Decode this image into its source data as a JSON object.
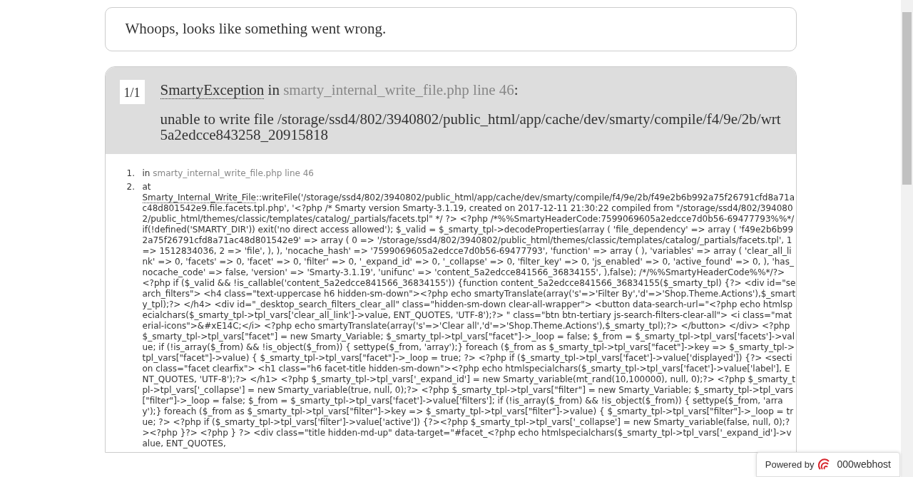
{
  "notice": "Whoops, looks like something went wrong.",
  "exception": {
    "counter": "1/1",
    "class": "SmartyException",
    "in": "in",
    "location": "smarty_internal_write_file.php line 46",
    "colon": ":",
    "message": "unable to write file /storage/ssd4/802/3940802/public_html/app/cache/dev/smarty/compile/f4/9e/2b/wrt5a2edcce843258_20915818"
  },
  "trace": [
    {
      "kind": "location",
      "number": "1.",
      "prefix": "in",
      "location": "smarty_internal_write_file.php line 46"
    },
    {
      "kind": "call",
      "number": "2.",
      "prefix": "at",
      "class": "Smarty_Internal_Write_File",
      "call": "::writeFile('/storage/ssd4/802/3940802/public_html/app/cache/dev/smarty/compile/f4/9e/2b/f49e2b6b992a75f26791cfd8a71ac48d801542e9.file.facets.tpl.php', '<?php /* Smarty version Smarty-3.1.19, created on 2017-12-11 21:30:22 compiled from \"/storage/ssd4/802/3940802/public_html/themes/classic/templates/catalog/_partials/facets.tpl\" */ ?> <?php /*%%SmartyHeaderCode:7599069605a2edcce7d0b56-69477793%%*/if(!defined('SMARTY_DIR')) exit('no direct access allowed'); $_valid = $_smarty_tpl->decodeProperties(array ( 'file_dependency' => array ( 'f49e2b6b992a75f26791cfd8a71ac48d801542e9' => array ( 0 => '/storage/ssd4/802/3940802/public_html/themes/classic/templates/catalog/_partials/facets.tpl', 1 => 1512834036, 2 => 'file', ), ), 'nocache_hash' => '7599069605a2edcce7d0b56-69477793', 'function' => array ( ), 'variables' => array ( 'clear_all_link' => 0, 'facets' => 0, 'facet' => 0, 'filter' => 0, '_expand_id' => 0, '_collapse' => 0, 'filter_key' => 0, 'js_enabled' => 0, 'active_found' => 0, ), 'has_nocache_code' => false, 'version' => 'Smarty-3.1.19', 'unifunc' => 'content_5a2edcce841566_36834155', ),false); /*/%%SmartyHeaderCode%%*/?> <?php if ($_valid && !is_callable('content_5a2edcce841566_36834155')) {function content_5a2edcce841566_36834155($_smarty_tpl) {?> <div id=\"search_filters\"> <h4 class=\"text-uppercase h6 hidden-sm-down\"><?php echo smartyTranslate(array('s'=>'Filter By','d'=>'Shop.Theme.Actions'),$_smarty_tpl);?> </h4> <div id=\"_desktop_search_filters_clear_all\" class=\"hidden-sm-down clear-all-wrapper\"> <button data-search-url=\"<?php echo htmlspecialchars($_smarty_tpl->tpl_vars['clear_all_link']->value, ENT_QUOTES, 'UTF-8');?> \" class=\"btn btn-tertiary js-search-filters-clear-all\"> <i class=\"material-icons\">&#xE14C;</i> <?php echo smartyTranslate(array('s'=>'Clear all','d'=>'Shop.Theme.Actions'),$_smarty_tpl);?> </button> </div> <?php $_smarty_tpl->tpl_vars[\"facet\"] = new Smarty_Variable; $_smarty_tpl->tpl_vars[\"facet\"]->_loop = false; $_from = $_smarty_tpl->tpl_vars['facets']->value; if (!is_array($_from) && !is_object($_from)) { settype($_from, 'array');} foreach ($_from as $_smarty_tpl->tpl_vars[\"facet\"]->key => $_smarty_tpl->tpl_vars[\"facet\"]->value) { $_smarty_tpl->tpl_vars[\"facet\"]->_loop = true; ?> <?php if ($_smarty_tpl->tpl_vars['facet']->value['displayed']) {?> <section class=\"facet clearfix\"> <h1 class=\"h6 facet-title hidden-sm-down\"><?php echo htmlspecialchars($_smarty_tpl->tpl_vars['facet']->value['label'], ENT_QUOTES, 'UTF-8');?> </h1> <?php $_smarty_tpl->tpl_vars['_expand_id'] = new Smarty_variable(mt_rand(10,100000), null, 0);?> <?php $_smarty_tpl->tpl_vars['_collapse'] = new Smarty_variable(true, null, 0);?> <?php $_smarty_tpl->tpl_vars[\"filter\"] = new Smarty_Variable; $_smarty_tpl->tpl_vars[\"filter\"]->_loop = false; $_from = $_smarty_tpl->tpl_vars['facet']->value['filters']; if (!is_array($_from) && !is_object($_from)) { settype($_from, 'array');} foreach ($_from as $_smarty_tpl->tpl_vars[\"filter\"]->key => $_smarty_tpl->tpl_vars[\"filter\"]->value) { $_smarty_tpl->tpl_vars[\"filter\"]->_loop = true; ?> <?php if ($_smarty_tpl->tpl_vars['filter']->value['active']) {?><?php $_smarty_tpl->tpl_vars['_collapse'] = new Smarty_variable(false, null, 0);?><?php }?> <?php } ?> <div class=\"title hidden-md-up\" data-target=\"#facet_<?php echo htmlspecialchars($_smarty_tpl->tpl_vars['_expand_id']->value, ENT_QUOTES,"
    }
  ],
  "badge": {
    "label": "Powered by",
    "brand": "000webhost"
  }
}
